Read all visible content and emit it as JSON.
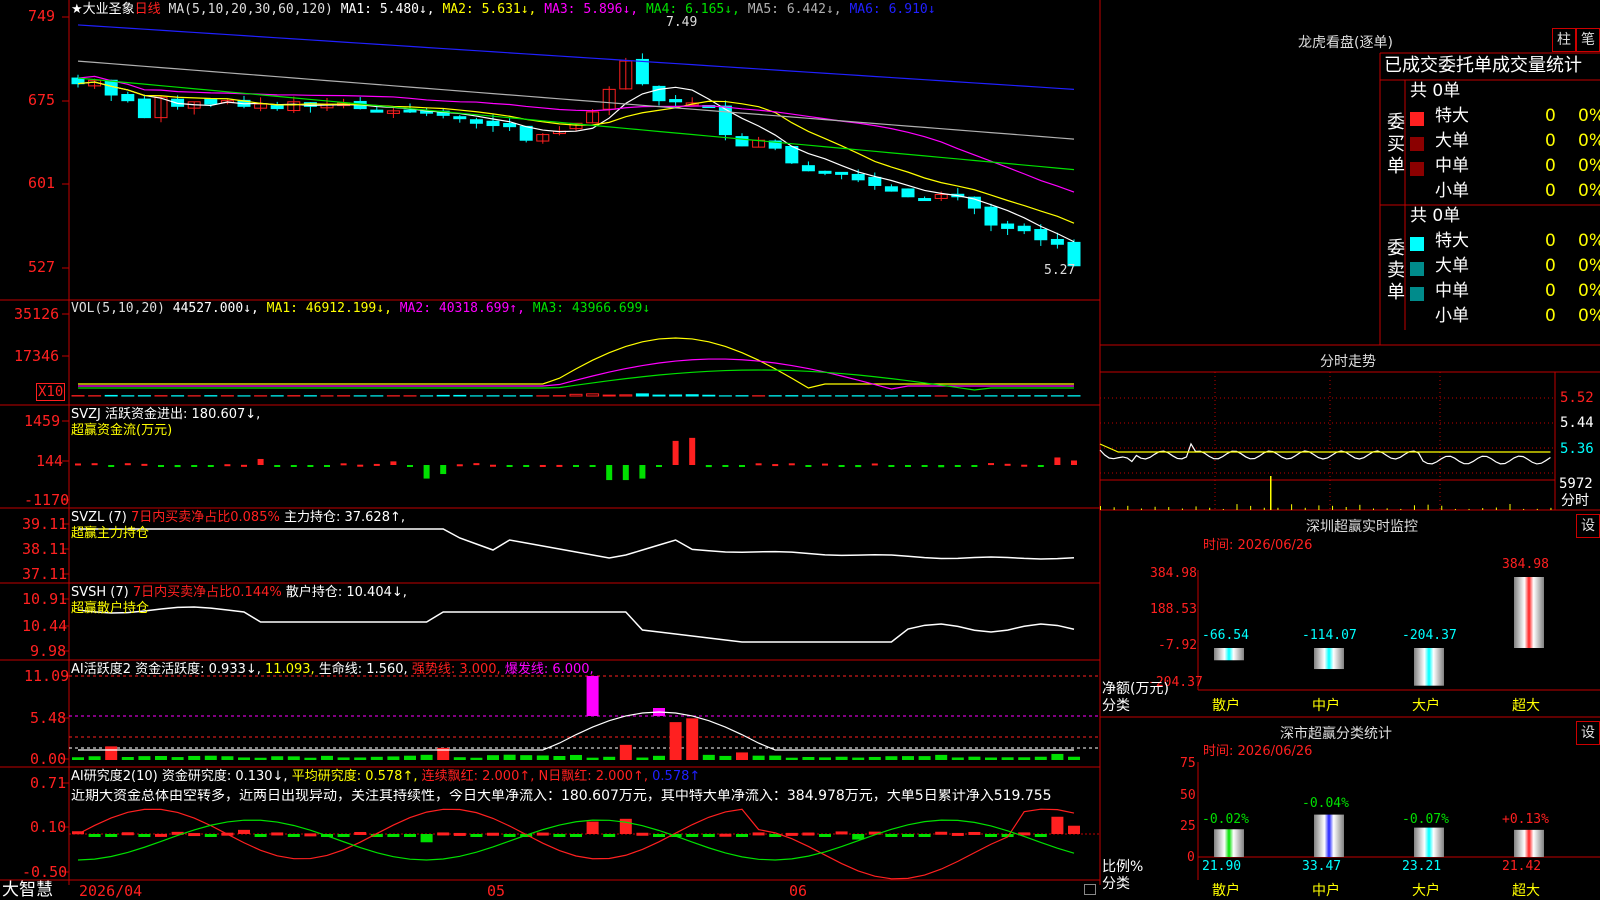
{
  "colors": {
    "up": "#ff2020",
    "down": "#00ffff",
    "grid": "#c00000",
    "green": "#00e000",
    "yellow": "#ffff00",
    "magenta": "#ff00ff",
    "white": "#ffffff",
    "blue": "#2020ff",
    "gray": "#b0b0b0"
  },
  "main": {
    "title": "★大业圣象",
    "period": "日线",
    "ma_label": "MA(5,10,20,30,60,120)",
    "ma1": "MA1: 5.480↓,",
    "ma2": "MA2: 5.631↓,",
    "ma3": "MA3: 5.896↓,",
    "ma4": "MA4: 6.165↓,",
    "ma5": "MA5: 6.442↓,",
    "ma6": "MA6: 6.910↓",
    "axis": [
      "749",
      "675",
      "601",
      "527"
    ],
    "high_marker": "7.49",
    "low_marker": "5.27"
  },
  "vol": {
    "label": "VOL(5,10,20)",
    "v": "44527.000↓,",
    "ma1": "MA1: 46912.199↓,",
    "ma2": "MA2: 40318.699↑,",
    "ma3": "MA3: 43966.699↓",
    "axis": [
      "35126",
      "17346"
    ],
    "unit": "X10"
  },
  "svzj": {
    "label": "SVZJ 活跃资金进出: 180.607↓,",
    "sub": "超赢资金流(万元)",
    "axis": [
      "1459",
      "144",
      "-1170"
    ]
  },
  "svzl": {
    "label": "SVZL (7)",
    "pct": "7日内买卖净占比0.085%",
    "hold": "主力持仓: 37.628↑,",
    "sub": "超赢主力持仓",
    "axis": [
      "39.11",
      "38.11",
      "37.11"
    ]
  },
  "svsh": {
    "label": "SVSH (7)",
    "pct": "7日内买卖净占比0.144%",
    "hold": "散户持仓: 10.404↓,",
    "sub": "超赢散户持仓",
    "axis": [
      "10.91",
      "10.44",
      "9.98"
    ]
  },
  "ai1": {
    "label": "AI活跃度2 资金活跃度: 0.933↓,",
    "v2": "11.093,",
    "life": "生命线: 1.560,",
    "strong": "强势线: 3.000,",
    "burst": "爆发线: 6.000,",
    "axis": [
      "11.09",
      "5.48",
      "0.00"
    ]
  },
  "ai2": {
    "label": "AI研究度2(10) 资金研究度: 0.130↓,",
    "avg": "平均研究度: 0.578↑,",
    "lx": "连续飘红: 2.000↑,",
    "nr": "N日飘红: 2.000↑,",
    "last": "0.578↑",
    "comment": "近期大资金总体由空转多，近两日出现异动，关注其持续性，今日大单净流入：180.607万元，其中特大单净流入：384.978万元，大单5日累计净入519.755",
    "axis": [
      "0.71",
      "0.10",
      "-0.50"
    ]
  },
  "xaxis": {
    "brand": "大智慧",
    "dates": [
      "2026/04",
      "05",
      "06"
    ]
  },
  "lh": {
    "title": "龙虎看盘(逐单)",
    "btn1": "柱",
    "btn2": "笔",
    "header": "已成交委托单成交量统计",
    "buy": {
      "side": "委买单",
      "count": "共 0单",
      "rows": [
        {
          "name": "特大",
          "v": "0",
          "p": "0%"
        },
        {
          "name": "大单",
          "v": "0",
          "p": "0%"
        },
        {
          "name": "中单",
          "v": "0",
          "p": "0%"
        },
        {
          "name": "小单",
          "v": "0",
          "p": "0%"
        }
      ]
    },
    "sell": {
      "side": "委卖单",
      "count": "共 0单",
      "rows": [
        {
          "name": "特大",
          "v": "0",
          "p": "0%"
        },
        {
          "name": "大单",
          "v": "0",
          "p": "0%"
        },
        {
          "name": "中单",
          "v": "0",
          "p": "0%"
        },
        {
          "name": "小单",
          "v": "0",
          "p": "0%"
        }
      ]
    }
  },
  "fs": {
    "title": "分时走势",
    "axis": [
      "5.52",
      "5.44",
      "5.36"
    ],
    "vol": "5972",
    "unit": "分时"
  },
  "szm": {
    "title": "深圳超赢实时监控",
    "btn": "设",
    "time": "时间: 2026/06/26",
    "axis": [
      "384.98",
      "188.53",
      "-7.92",
      "-204.37"
    ],
    "ylabel": "净额(万元)",
    "xlabel": "分类",
    "bars": [
      {
        "cat": "散户",
        "v": "-66.54"
      },
      {
        "cat": "中户",
        "v": "-114.07"
      },
      {
        "cat": "大户",
        "v": "-204.37"
      },
      {
        "cat": "超大",
        "v": "384.98"
      }
    ]
  },
  "szs": {
    "title": "深市超赢分类统计",
    "btn": "设",
    "time": "时间: 2026/06/26",
    "axis": [
      "75",
      "50",
      "25",
      "0"
    ],
    "ylabel": "比例%",
    "xlabel": "分类",
    "bars": [
      {
        "cat": "散户",
        "pct": "21.90",
        "chg": "-0.02%"
      },
      {
        "cat": "中户",
        "pct": "33.47",
        "chg": "-0.04%"
      },
      {
        "cat": "大户",
        "pct": "23.21",
        "chg": "-0.07%"
      },
      {
        "cat": "超大",
        "pct": "21.42",
        "chg": "+0.13%"
      }
    ]
  }
}
